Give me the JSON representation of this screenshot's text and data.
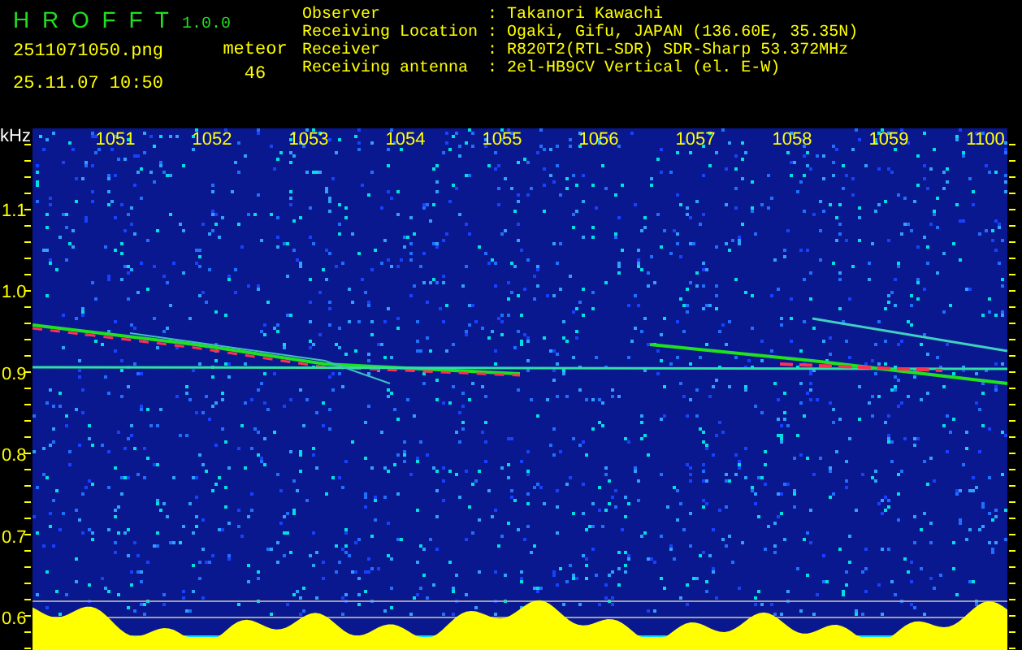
{
  "app": {
    "name": "H R O F F T",
    "version": "1.0.0"
  },
  "file_name": "2511071050.png",
  "timestamp": "25.11.07 10:50",
  "meteor": {
    "label": "meteor",
    "count": "46"
  },
  "info": [
    {
      "label": "Observer",
      "separator": ":",
      "value": "Takanori Kawachi"
    },
    {
      "label": "Receiving Location",
      "separator": ":",
      "value": "Ogaki, Gifu, JAPAN (136.60E, 35.35N)"
    },
    {
      "label": "Receiver",
      "separator": ":",
      "value": "R820T2(RTL-SDR) SDR-Sharp 53.372MHz"
    },
    {
      "label": "Receiving antenna",
      "separator": ":",
      "value": "2el-HB9CV Vertical (el. E-W)"
    }
  ],
  "spectrogram": {
    "unit": "kHz",
    "freq_labels": [
      "1.1",
      "1.0",
      "0.9",
      "0.8",
      "0.7",
      "0.6"
    ],
    "time_labels": [
      "1051",
      "1052",
      "1053",
      "1054",
      "1055",
      "1056",
      "1057",
      "1058",
      "1059",
      "1100"
    ]
  }
}
